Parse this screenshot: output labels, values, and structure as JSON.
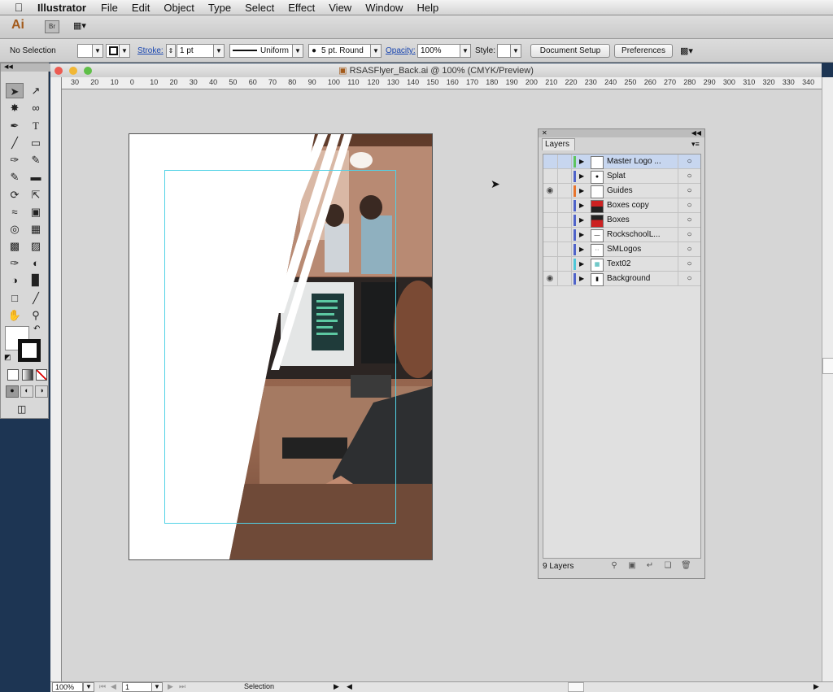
{
  "menubar": {
    "app_name": "Illustrator",
    "items": [
      "File",
      "Edit",
      "Object",
      "Type",
      "Select",
      "Effect",
      "View",
      "Window",
      "Help"
    ]
  },
  "appbar": {
    "logo": "Ai",
    "bridge": "Br"
  },
  "control_bar": {
    "selection_status": "No Selection",
    "stroke_label": "Stroke:",
    "stroke_value": "1 pt",
    "stroke_profile": "Uniform",
    "brush": "5 pt. Round",
    "opacity_label": "Opacity:",
    "opacity_value": "100%",
    "style_label": "Style:",
    "document_setup": "Document Setup",
    "preferences": "Preferences"
  },
  "document": {
    "title": "RSASFlyer_Back.ai @ 100% (CMYK/Preview)",
    "ruler_ticks": [
      "30",
      "20",
      "10",
      "0",
      "10",
      "20",
      "30",
      "40",
      "50",
      "60",
      "70",
      "80",
      "90",
      "100",
      "110",
      "120",
      "130",
      "140",
      "150",
      "160",
      "170",
      "180",
      "190",
      "200",
      "210",
      "220",
      "230",
      "240",
      "250",
      "260",
      "270",
      "280",
      "290",
      "300",
      "310",
      "320",
      "330",
      "340"
    ]
  },
  "status_bar": {
    "zoom": "100%",
    "artboard": "1",
    "tool": "Selection"
  },
  "layers_panel": {
    "tab": "Layers",
    "count_label": "9 Layers",
    "layers": [
      {
        "name": "Master Logo ...",
        "visible": false,
        "color": "#5ec45e",
        "selected": true
      },
      {
        "name": "Splat",
        "visible": false,
        "color": "#4f63c9",
        "selected": false
      },
      {
        "name": "Guides",
        "visible": true,
        "color": "#e8742c",
        "selected": false
      },
      {
        "name": "Boxes copy",
        "visible": false,
        "color": "#4f63c9",
        "selected": false
      },
      {
        "name": "Boxes",
        "visible": false,
        "color": "#4f63c9",
        "selected": false
      },
      {
        "name": "RockschoolL...",
        "visible": false,
        "color": "#4f63c9",
        "selected": false
      },
      {
        "name": "SMLogos",
        "visible": false,
        "color": "#4f63c9",
        "selected": false
      },
      {
        "name": "Text02",
        "visible": false,
        "color": "#4fc7d8",
        "selected": false
      },
      {
        "name": "Background",
        "visible": true,
        "color": "#4f63c9",
        "selected": false
      }
    ]
  }
}
